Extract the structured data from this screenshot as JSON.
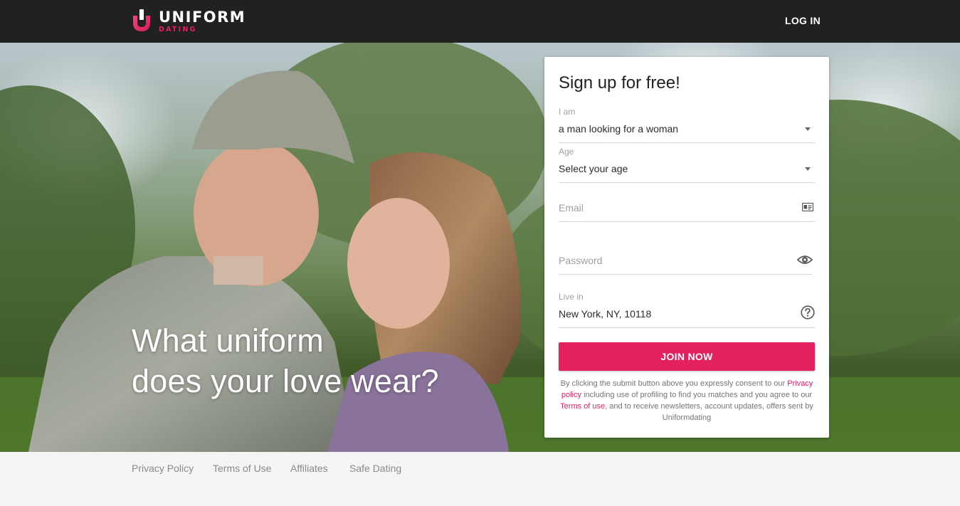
{
  "brand": {
    "name": "UNIFORM",
    "sub": "DATING",
    "accent_color": "#e3215f"
  },
  "header": {
    "login_label": "LOG IN"
  },
  "hero": {
    "headline_line1": "What uniform",
    "headline_line2": "does your love wear?"
  },
  "signup": {
    "title": "Sign up for free!",
    "i_am": {
      "label": "I am",
      "value": "a man looking for a woman"
    },
    "age": {
      "label": "Age",
      "value": "Select your age"
    },
    "email": {
      "placeholder": "Email",
      "icon": "id-card-icon"
    },
    "password": {
      "placeholder": "Password",
      "icon": "eye-icon"
    },
    "location": {
      "label": "Live in",
      "value": "New York, NY, 10118",
      "icon": "help-circle-icon"
    },
    "join_label": "JOIN NOW",
    "legal": {
      "part1": "By clicking the submit button above you expressly consent to our",
      "privacy_link": "Privacy policy",
      "part2": "including use of profiling to find you matches and you agree to our",
      "terms_link": "Terms of use",
      "part3": ", and to receive newsletters, account updates, offers sent by Uniformdating"
    }
  },
  "footer": {
    "links": [
      "Privacy Policy",
      "Terms of Use",
      "Affiliates",
      "Safe Dating"
    ]
  }
}
